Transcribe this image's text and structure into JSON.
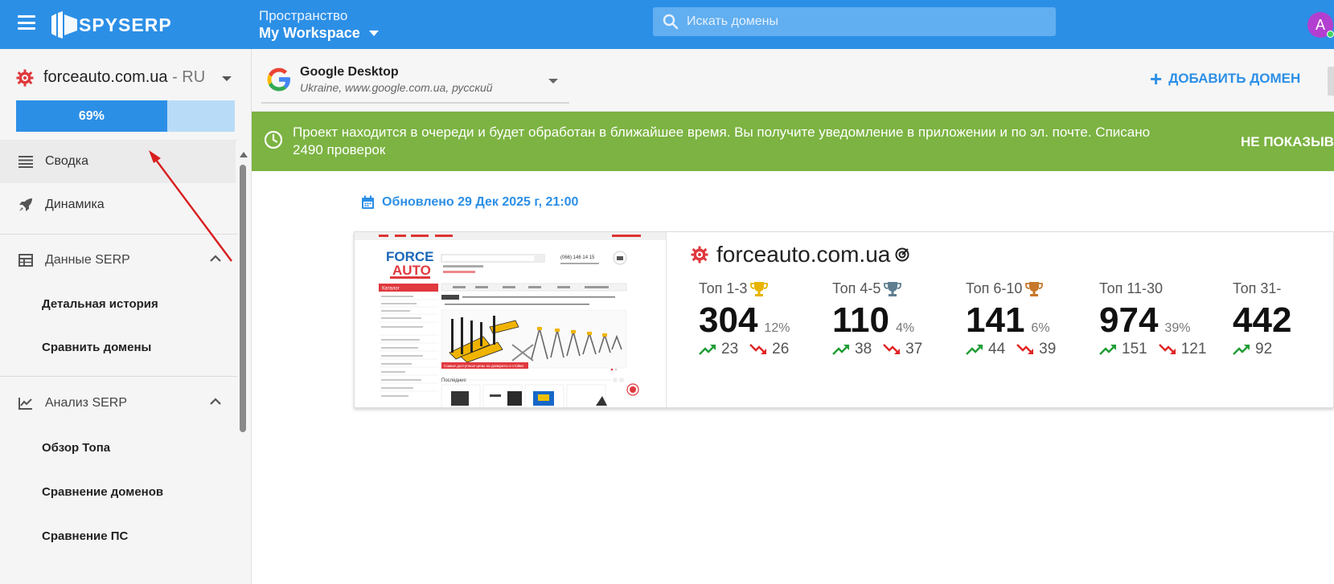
{
  "topbar": {
    "logo_text": "SPYSERP",
    "workspace_label": "Пространство",
    "workspace_name": "My Workspace",
    "search_placeholder": "Искать домены",
    "avatar_letter": "A"
  },
  "project": {
    "domain": "forceauto.com.ua",
    "region": " - RU",
    "progress_label": "69%",
    "progress_value": 0.69
  },
  "sidebar": {
    "items": [
      {
        "label": "Сводка",
        "icon": "list-icon",
        "active": true
      },
      {
        "label": "Динамика",
        "icon": "rocket-icon"
      },
      {
        "label": "Данные SERP",
        "icon": "table-icon",
        "group": true
      },
      {
        "label": "Детальная история",
        "sub": true
      },
      {
        "label": "Сравнить домены",
        "sub": true
      },
      {
        "label": "Анализ SERP",
        "icon": "chart-line-icon",
        "group": true
      },
      {
        "label": "Обзор Топа",
        "sub": true
      },
      {
        "label": "Сравнение доменов",
        "sub": true
      },
      {
        "label": "Сравнение ПС",
        "sub": true
      }
    ]
  },
  "engine": {
    "name": "Google Desktop",
    "subtitle": "Ukraine, www.google.com.ua, русский"
  },
  "add_domain_label": "ДОБАВИТЬ ДОМЕН",
  "notice": {
    "text": "Проект находится в очереди и будет обработан в ближайшее время. Вы получите уведомление в приложении и по эл. почте. Списано 2490 проверок",
    "button": "НЕ ПОКАЗЫВ"
  },
  "updated": "Обновлено 29 Дек 2025 г, 21:00",
  "summary": {
    "domain": "forceauto.com.ua",
    "stats": [
      {
        "label": "Топ 1-3",
        "value": "304",
        "pct": "12%",
        "up": "23",
        "down": "26",
        "trophy": "#e8b400"
      },
      {
        "label": "Топ 4-5",
        "value": "110",
        "pct": "4%",
        "up": "38",
        "down": "37",
        "trophy": "#5f7f91"
      },
      {
        "label": "Топ 6-10",
        "value": "141",
        "pct": "6%",
        "up": "44",
        "down": "39",
        "trophy": "#c7782a"
      },
      {
        "label": "Топ 11-30",
        "value": "974",
        "pct": "39%",
        "up": "151",
        "down": "121"
      },
      {
        "label": "Топ 31-",
        "value": "442",
        "pct": "",
        "up": "92",
        "down": ""
      }
    ]
  },
  "thumbnail": {
    "logo_top": "FORCE",
    "logo_bottom": "AUTO",
    "phone": "(066) 146 14 15",
    "menu_title": "Каталог",
    "banner_text": "Самые доступные цены на домкраты и стойки",
    "latest": "Последние"
  },
  "colors": {
    "brand": "#2c8fe6",
    "notice": "#7cb342",
    "up": "#1f9d34",
    "down": "#e02424"
  }
}
